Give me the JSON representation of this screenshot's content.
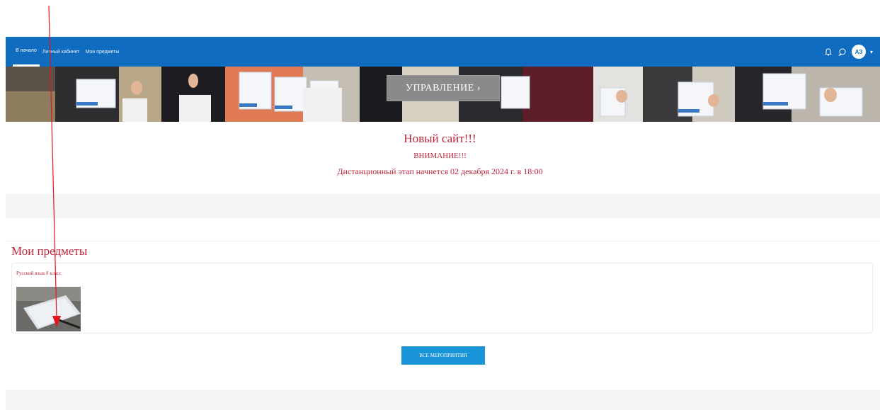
{
  "navbar": {
    "items": [
      {
        "label": "В начало"
      },
      {
        "label": "Личный кабинет"
      },
      {
        "label": "Мои предметы"
      }
    ],
    "user_initials": "АЗ",
    "bell_icon": "bell-icon",
    "chat_icon": "chat-icon",
    "caret_icon": "chevron-down-icon",
    "color": "#0f6cbf"
  },
  "banner": {
    "button_label": "УПРАВЛЕНИЕ ›"
  },
  "announcement": {
    "line1": "Новый сайт!!!",
    "line2": "ВНИМАНИЕ!!!",
    "line3": "Дистанционный этап начнется 02 декабря 2024 г. в 18:00",
    "color": "#c0263c"
  },
  "my_courses": {
    "title": "Мои предметы",
    "courses": [
      {
        "name": "Русский язык 8 класс"
      }
    ],
    "all_button": "ВСЕ МЕРОПРИЯТИЯ"
  }
}
